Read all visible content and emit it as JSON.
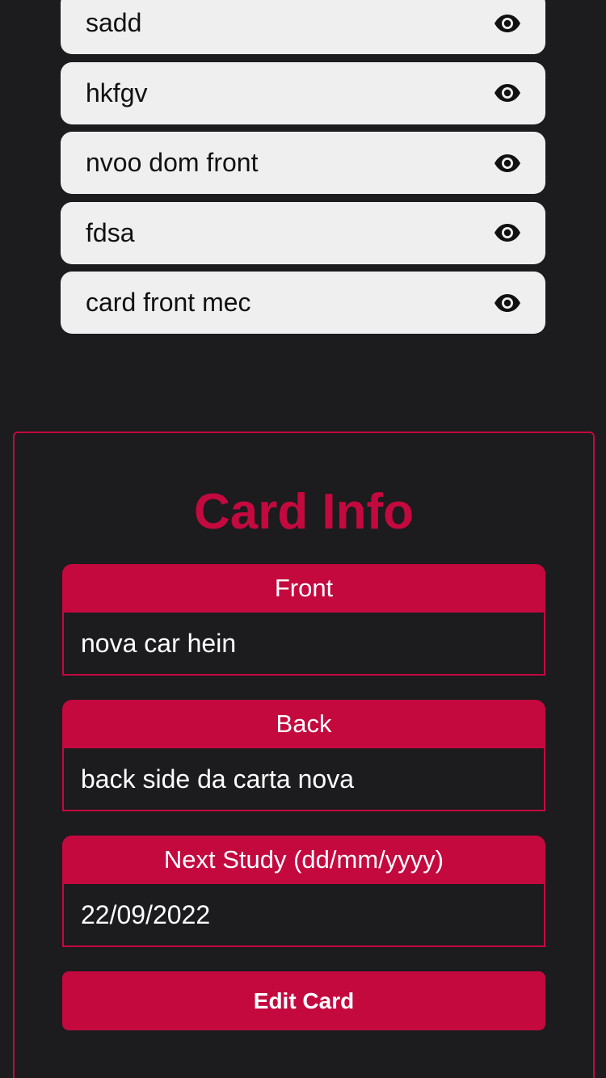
{
  "card_list": {
    "items": [
      {
        "label": "sadd",
        "icon": "eye-icon"
      },
      {
        "label": "hkfgv",
        "icon": "eye-icon"
      },
      {
        "label": "nvoo dom front",
        "icon": "eye-icon"
      },
      {
        "label": "fdsa",
        "icon": "eye-icon"
      },
      {
        "label": "card front mec",
        "icon": "eye-icon"
      }
    ]
  },
  "card_info": {
    "title": "Card Info",
    "front": {
      "label": "Front",
      "value": "nova car hein"
    },
    "back": {
      "label": "Back",
      "value": "back side da carta nova"
    },
    "next_study": {
      "label": "Next Study (dd/mm/yyyy)",
      "value": "22/09/2022"
    },
    "edit_label": "Edit Card"
  },
  "colors": {
    "background": "#1c1b1e",
    "accent": "#c4093f",
    "card_item_bg": "#efefef"
  }
}
